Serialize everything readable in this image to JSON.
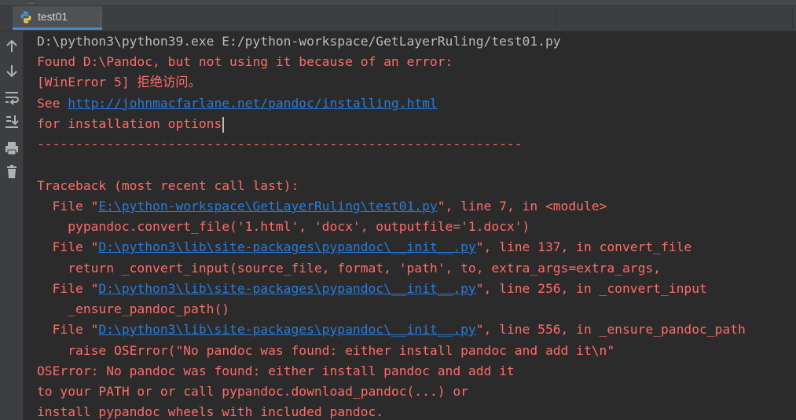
{
  "window": {
    "background_title": "...",
    "tab": {
      "label": "test01",
      "icon": "python-icon"
    }
  },
  "toolbar": {
    "buttons": [
      {
        "name": "scroll-up-icon"
      },
      {
        "name": "scroll-down-icon"
      },
      {
        "name": "soft-wrap-icon"
      },
      {
        "name": "scroll-to-end-icon"
      },
      {
        "name": "print-icon"
      },
      {
        "name": "clear-all-icon"
      }
    ]
  },
  "console": {
    "colors": {
      "stdout": "#bbbbbb",
      "stderr": "#ff6b68",
      "link": "#287bde"
    },
    "command": "D:\\python3\\python39.exe E:/python-workspace/GetLayerRuling/test01.py",
    "found_line": "Found D:\\Pandoc, but not using it because of an error:",
    "winerror_line": "[WinError 5] 拒绝访问。",
    "see_prefix": "See ",
    "see_url": "http://johnmacfarlane.net/pandoc/installing.html",
    "options_line": "for installation options",
    "dash_line": "---------------------------------------------------------------",
    "traceback_header": "Traceback (most recent call last):",
    "frames": [
      {
        "prefix": "  File \"",
        "path": "E:\\python-workspace\\GetLayerRuling\\test01.py",
        "suffix": "\", line 7, in <module>",
        "code": "    pypandoc.convert_file('1.html', 'docx', outputfile='1.docx')"
      },
      {
        "prefix": "  File \"",
        "path": "D:\\python3\\lib\\site-packages\\pypandoc\\__init__.py",
        "suffix": "\", line 137, in convert_file",
        "code": "    return _convert_input(source_file, format, 'path', to, extra_args=extra_args,"
      },
      {
        "prefix": "  File \"",
        "path": "D:\\python3\\lib\\site-packages\\pypandoc\\__init__.py",
        "suffix": "\", line 256, in _convert_input",
        "code": "    _ensure_pandoc_path()"
      },
      {
        "prefix": "  File \"",
        "path": "D:\\python3\\lib\\site-packages\\pypandoc\\__init__.py",
        "suffix": "\", line 556, in _ensure_pandoc_path",
        "code": "    raise OSError(\"No pandoc was found: either install pandoc and add it\\n\""
      }
    ],
    "error_lines": [
      "OSError: No pandoc was found: either install pandoc and add it",
      "to your PATH or or call pypandoc.download_pandoc(...) or",
      "install pypandoc wheels with included pandoc."
    ]
  }
}
